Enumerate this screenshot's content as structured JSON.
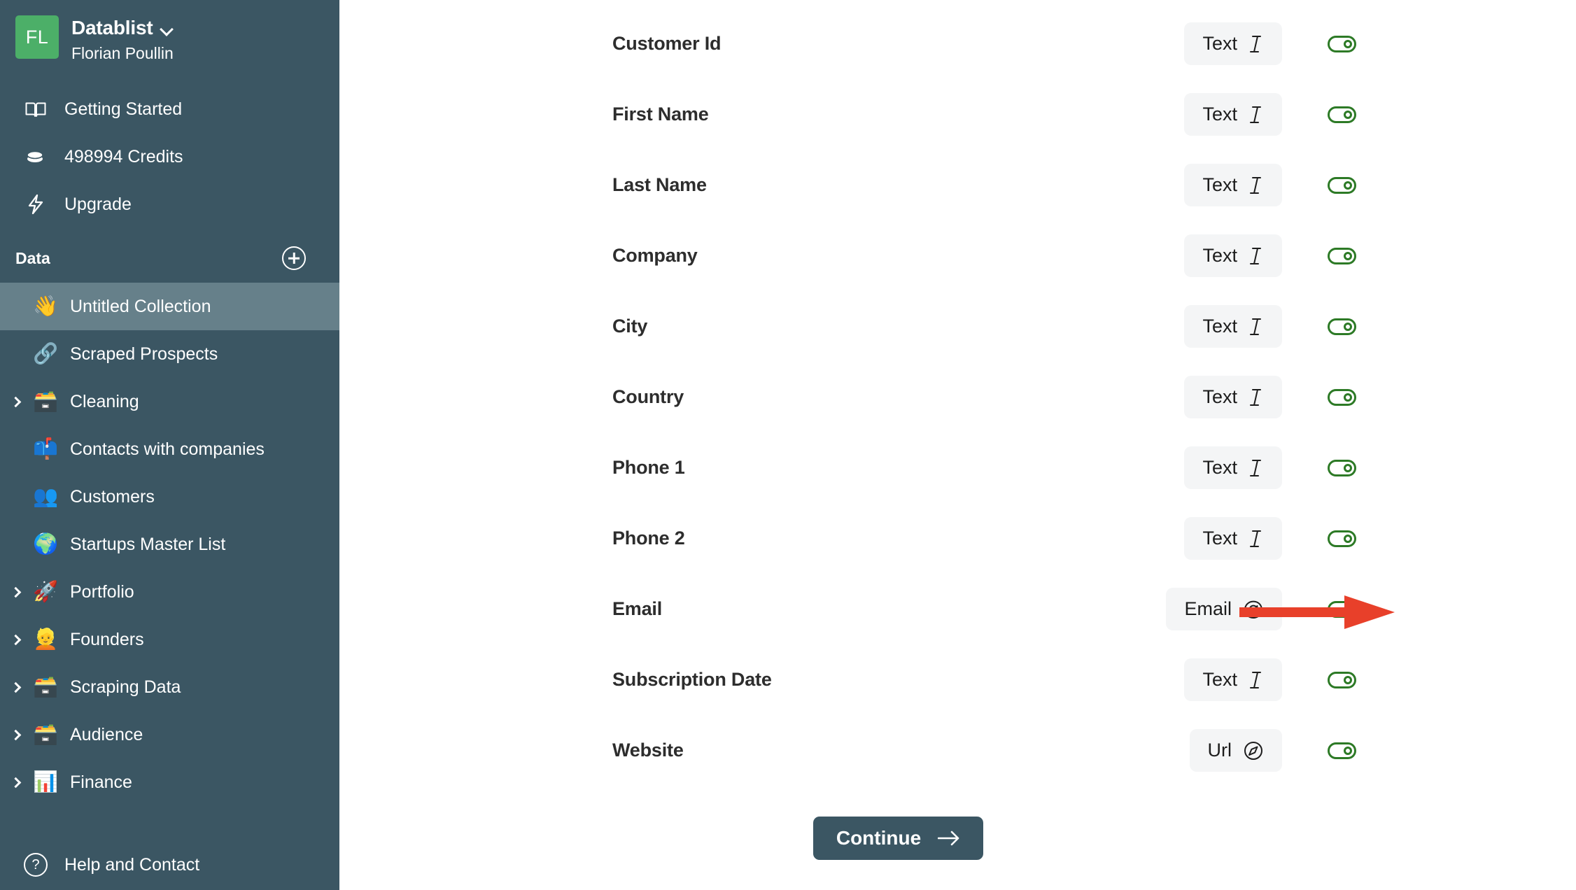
{
  "sidebar": {
    "avatar_initials": "FL",
    "org_name": "Datablist",
    "user_name": "Florian Poullin",
    "links": [
      {
        "icon": "book-open-icon",
        "label": "Getting Started"
      },
      {
        "icon": "coins-icon",
        "label": "498994 Credits"
      },
      {
        "icon": "lightning-bolt-icon",
        "label": "Upgrade"
      }
    ],
    "section_title": "Data",
    "add_button_label": "+",
    "collections": [
      {
        "emoji": "👋",
        "label": "Untitled Collection",
        "expandable": false,
        "active": true
      },
      {
        "emoji": "🔗",
        "label": "Scraped Prospects",
        "expandable": false,
        "active": false
      },
      {
        "emoji": "🗃️",
        "label": "Cleaning",
        "expandable": true,
        "active": false
      },
      {
        "emoji": "📫",
        "label": "Contacts with companies",
        "expandable": false,
        "active": false
      },
      {
        "emoji": "👥",
        "label": "Customers",
        "expandable": false,
        "active": false
      },
      {
        "emoji": "🌍",
        "label": "Startups Master List",
        "expandable": false,
        "active": false
      },
      {
        "emoji": "🚀",
        "label": "Portfolio",
        "expandable": true,
        "active": false
      },
      {
        "emoji": "👱",
        "label": "Founders",
        "expandable": true,
        "active": false
      },
      {
        "emoji": "🗃️",
        "label": "Scraping Data",
        "expandable": true,
        "active": false
      },
      {
        "emoji": "🗃️",
        "label": "Audience",
        "expandable": true,
        "active": false
      },
      {
        "emoji": "📊",
        "label": "Finance",
        "expandable": true,
        "active": false
      }
    ],
    "footer": {
      "icon": "question-circle-icon",
      "label": "Help and Contact"
    }
  },
  "main": {
    "fields": [
      {
        "name": "Customer Id",
        "type": "Text",
        "type_icon": "italic-i-icon",
        "enabled": true
      },
      {
        "name": "First Name",
        "type": "Text",
        "type_icon": "italic-i-icon",
        "enabled": true
      },
      {
        "name": "Last Name",
        "type": "Text",
        "type_icon": "italic-i-icon",
        "enabled": true
      },
      {
        "name": "Company",
        "type": "Text",
        "type_icon": "italic-i-icon",
        "enabled": true
      },
      {
        "name": "City",
        "type": "Text",
        "type_icon": "italic-i-icon",
        "enabled": true
      },
      {
        "name": "Country",
        "type": "Text",
        "type_icon": "italic-i-icon",
        "enabled": true
      },
      {
        "name": "Phone 1",
        "type": "Text",
        "type_icon": "italic-i-icon",
        "enabled": true
      },
      {
        "name": "Phone 2",
        "type": "Text",
        "type_icon": "italic-i-icon",
        "enabled": true
      },
      {
        "name": "Email",
        "type": "Email",
        "type_icon": "at-sign-icon",
        "enabled": true
      },
      {
        "name": "Subscription Date",
        "type": "Text",
        "type_icon": "italic-i-icon",
        "enabled": true
      },
      {
        "name": "Website",
        "type": "Url",
        "type_icon": "compass-icon",
        "enabled": true
      }
    ],
    "continue_label": "Continue",
    "annotation": {
      "type": "arrow",
      "points_to": "Email",
      "color": "#e8402a"
    }
  },
  "colors": {
    "sidebar_bg": "#3b5663",
    "sidebar_active": "#66808a",
    "avatar_green": "#4caf68",
    "toggle_green": "#2d7a26",
    "pill_bg": "#f4f5f6",
    "arrow_red": "#e8402a"
  }
}
